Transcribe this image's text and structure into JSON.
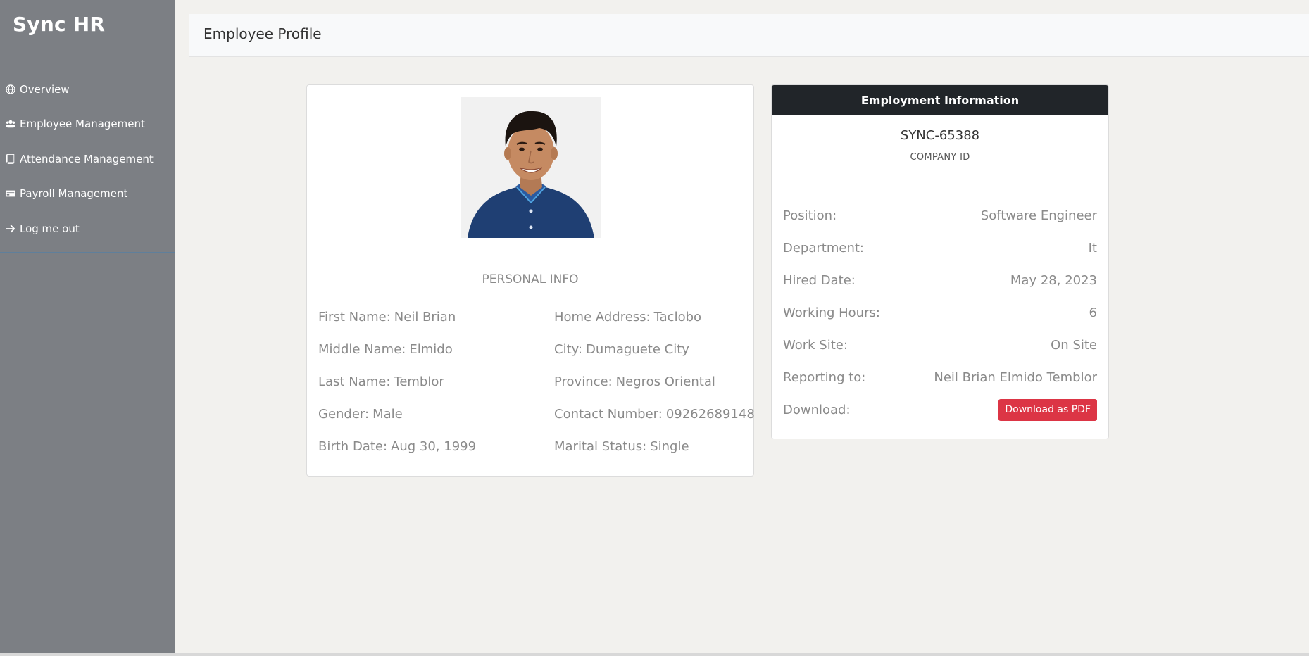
{
  "app": {
    "brand": "Sync HR"
  },
  "sidebar": {
    "items": [
      {
        "label": "Overview",
        "icon": "globe-icon"
      },
      {
        "label": "Employee Management",
        "icon": "users-icon"
      },
      {
        "label": "Attendance Management",
        "icon": "book-icon"
      },
      {
        "label": "Payroll Management",
        "icon": "credit-card-icon"
      },
      {
        "label": "Log me out",
        "icon": "arrow-right-icon"
      }
    ]
  },
  "header": {
    "title": "Employee Profile"
  },
  "personal": {
    "section_title": "PERSONAL INFO",
    "left": [
      {
        "label": "First Name:",
        "value": "Neil Brian"
      },
      {
        "label": "Middle Name:",
        "value": "Elmido"
      },
      {
        "label": "Last Name:",
        "value": "Temblor"
      },
      {
        "label": "Gender:",
        "value": "Male"
      },
      {
        "label": "Birth Date:",
        "value": "Aug 30, 1999"
      }
    ],
    "right": [
      {
        "label": "Home Address:",
        "value": "Taclobo"
      },
      {
        "label": "City:",
        "value": "Dumaguete City"
      },
      {
        "label": "Province:",
        "value": "Negros Oriental"
      },
      {
        "label": "Contact Number:",
        "value": "09262689148"
      },
      {
        "label": "Marital Status:",
        "value": "Single"
      }
    ]
  },
  "employment": {
    "title": "Employment Information",
    "company_id": "SYNC-65388",
    "company_id_label": "COMPANY ID",
    "rows": [
      {
        "label": "Position:",
        "value": "Software Engineer"
      },
      {
        "label": "Department:",
        "value": "It"
      },
      {
        "label": "Hired Date:",
        "value": "May 28, 2023"
      },
      {
        "label": "Working Hours:",
        "value": "6"
      },
      {
        "label": "Work Site:",
        "value": "On Site"
      },
      {
        "label": "Reporting to:",
        "value": "Neil Brian Elmido Temblor"
      }
    ],
    "download_label": "Download:",
    "download_button": "Download as PDF"
  },
  "colors": {
    "sidebar_bg": "#7c7f84",
    "card_header_bg": "#212529",
    "danger": "#dc3545",
    "page_bg": "#f2f1ee"
  }
}
